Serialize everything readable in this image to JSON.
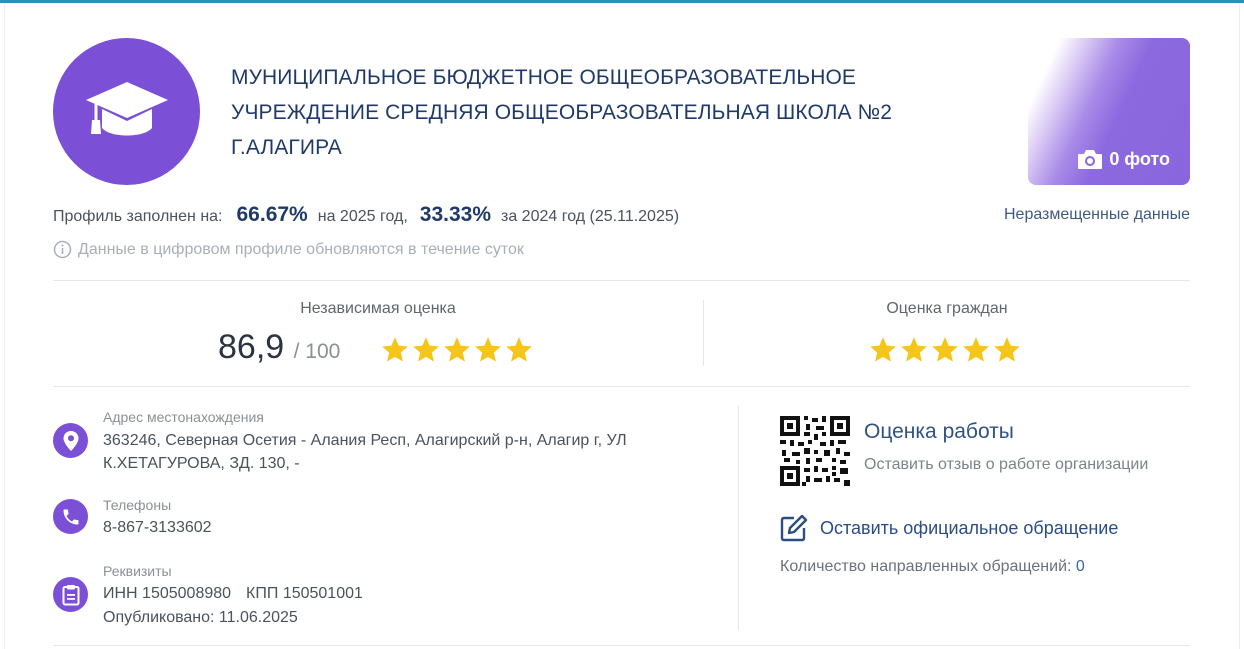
{
  "colors": {
    "accent": "#7b4fd6",
    "title": "#1f3a68",
    "link": "#2f5286",
    "star": "#f5c518",
    "topbar": "#2b91b8"
  },
  "org": {
    "logo_icon": "graduation-cap-icon",
    "name": "МУНИЦИПАЛЬНОЕ БЮДЖЕТНОЕ ОБЩЕОБРАЗОВАТЕЛЬНОЕ УЧРЕЖДЕНИЕ СРЕДНЯЯ ОБЩЕОБРАЗОВАТЕЛЬНАЯ ШКОЛА №2 Г.АЛАГИРА"
  },
  "photos": {
    "icon": "camera-icon",
    "label": "0 фото"
  },
  "profile": {
    "label": "Профиль заполнен на:",
    "pct_current": "66.67%",
    "current_year_text": "на 2025 год,",
    "pct_previous": "33.33%",
    "previous_year_text": "за 2024 год (25.11.2025)",
    "unplaced_link": "Неразмещенные данные",
    "note_icon": "info-circle-icon",
    "note": "Данные в цифровом профиле обновляются в течение суток"
  },
  "ratings": {
    "independent": {
      "label": "Независимая оценка",
      "score": "86,9",
      "max": "/ 100",
      "stars": 5
    },
    "citizens": {
      "label": "Оценка граждан",
      "stars": 5
    }
  },
  "contacts": {
    "address": {
      "icon": "location-pin-icon",
      "label": "Адрес местонахождения",
      "line1": "363246, Северная Осетия - Алания Респ, Алагирский р-н, Алагир г, УЛ",
      "line2": "К.ХЕТАГУРОВА, ЗД. 130, -"
    },
    "phones": {
      "icon": "phone-icon",
      "label": "Телефоны",
      "value": "8-867-3133602"
    },
    "requisites": {
      "icon": "clipboard-icon",
      "label": "Реквизиты",
      "inn": "ИНН 1505008980",
      "kpp": "КПП 150501001",
      "published": "Опубликовано: 11.06.2025"
    }
  },
  "feedback": {
    "qr_icon": "qr-code-icon",
    "title": "Оценка работы",
    "subtitle": "Оставить отзыв о работе организации",
    "appeal_icon": "edit-icon",
    "appeal_label": "Оставить официальное обращение",
    "count_label": "Количество направленных обращений:",
    "count_value": "0"
  }
}
